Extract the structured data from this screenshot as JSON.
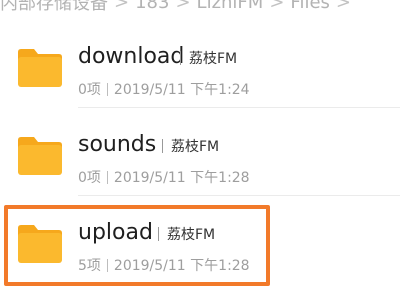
{
  "breadcrumb": [
    "内部存储设备",
    "183",
    "LizhiFM",
    "Files"
  ],
  "breadcrumb_separator": ">",
  "files": [
    {
      "name": "download",
      "source": "荔枝FM",
      "count": "0项",
      "date": "2019/5/11 下午1:24"
    },
    {
      "name": "sounds",
      "source": "荔枝FM",
      "count": "0项",
      "date": "2019/5/11 下午1:28"
    },
    {
      "name": "upload",
      "source": "荔枝FM",
      "count": "5项",
      "date": "2019/5/11 下午1:28"
    }
  ],
  "colors": {
    "folder": "#fbb92e",
    "folder_tab": "#f6a81c",
    "highlight": "#f27a2a"
  },
  "icons": {
    "folder": "folder-icon"
  }
}
